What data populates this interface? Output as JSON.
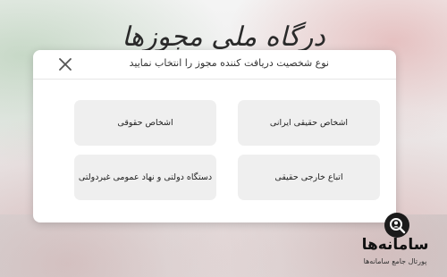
{
  "background": {
    "title": "درگاه ملی مجوزها"
  },
  "dialog": {
    "title": "نوع شخصیت دریافت کننده مجوز را انتخاب نمایید",
    "close_icon": "close-icon",
    "options": [
      {
        "label": "اشخاص حقیقی ایرانی"
      },
      {
        "label": "اشخاص حقوقی"
      },
      {
        "label": "اتباع خارجی حقیقی"
      },
      {
        "label": "دستگاه دولتی و نهاد عمومی غیردولتی"
      }
    ]
  },
  "branding": {
    "name": "سامانه‌ها",
    "tagline": "پورتال جامع سامانه‌ها",
    "icon": "magnifier-person-icon"
  },
  "colors": {
    "option_bg": "#efefef",
    "dialog_bg": "#ffffff",
    "text": "#222222"
  }
}
